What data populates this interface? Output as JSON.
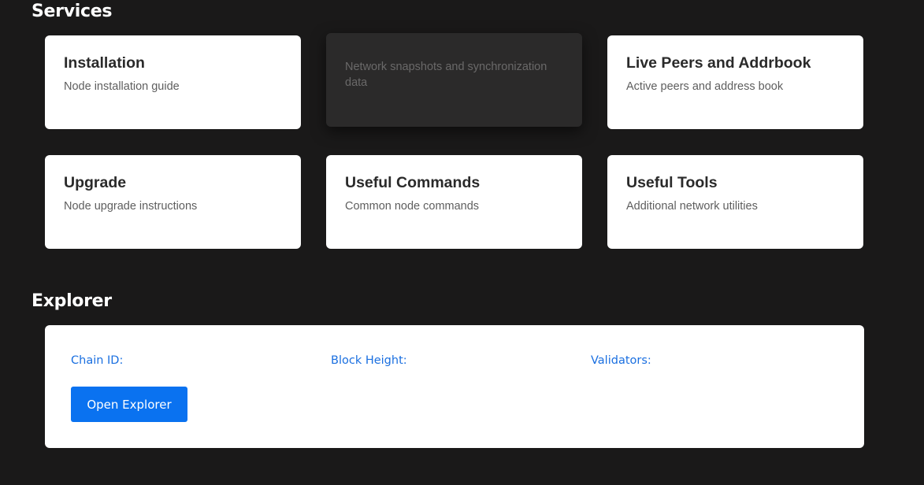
{
  "services": {
    "title": "Services",
    "cards": [
      {
        "title": "Installation",
        "description": "Node installation guide"
      },
      {
        "title": "",
        "description": "Network snapshots and synchronization data"
      },
      {
        "title": "Live Peers and Addrbook",
        "description": "Active peers and address book"
      },
      {
        "title": "Upgrade",
        "description": "Node upgrade instructions"
      },
      {
        "title": "Useful Commands",
        "description": "Common node commands"
      },
      {
        "title": "Useful Tools",
        "description": "Additional network utilities"
      }
    ]
  },
  "explorer": {
    "title": "Explorer",
    "chain_id_label": "Chain ID:",
    "block_height_label": "Block Height:",
    "validators_label": "Validators:",
    "open_button_label": "Open Explorer"
  },
  "colors": {
    "background": "#1a1919",
    "card": "#ffffff",
    "accent": "#0a72f0",
    "label_blue": "#1a6fe0"
  }
}
